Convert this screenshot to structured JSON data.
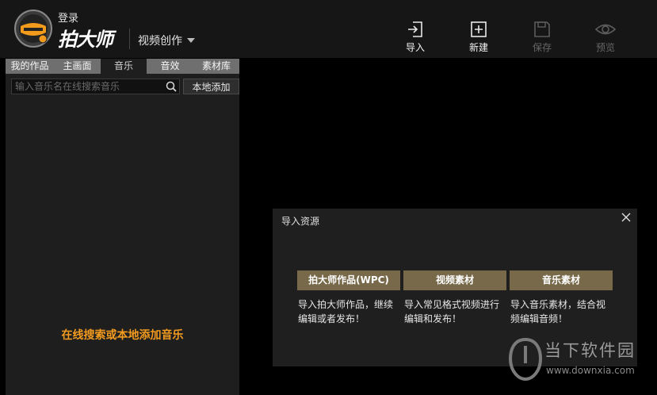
{
  "header": {
    "login_label": "登录",
    "brand": "拍大师",
    "mode_label": "视频创作",
    "tools": [
      {
        "label": "导入",
        "icon": "import-icon",
        "enabled": true
      },
      {
        "label": "新建",
        "icon": "new-icon",
        "enabled": true
      },
      {
        "label": "保存",
        "icon": "save-icon",
        "enabled": false
      },
      {
        "label": "预览",
        "icon": "preview-eye-icon",
        "enabled": false
      }
    ]
  },
  "left_panel": {
    "tabs": [
      {
        "label": "我的作品"
      },
      {
        "label": "主画面"
      },
      {
        "label": "音乐",
        "active": true
      },
      {
        "label": "音效"
      },
      {
        "label": "素材库"
      }
    ],
    "search": {
      "placeholder": "输入音乐名在线搜索音乐"
    },
    "add_local_label": "本地添加",
    "empty_hint": "在线搜索或本地添加音乐"
  },
  "dialog": {
    "title": "导入资源",
    "options": [
      {
        "label": "拍大师作品(WPC)",
        "desc": "导入拍大师作品，继续编辑或者发布！"
      },
      {
        "label": "视频素材",
        "desc": "导入常见格式视频进行编辑和发布！"
      },
      {
        "label": "音乐素材",
        "desc": "导入音乐素材，结合视频编辑音频！"
      }
    ]
  },
  "watermark": {
    "name": "当下软件园",
    "url": "www.downxia.com"
  },
  "colors": {
    "accent_orange": "#f39b1f",
    "dialog_button": "#77694a",
    "tab_light": "#6f6f6f",
    "panel_bg": "#1e1e1e"
  }
}
